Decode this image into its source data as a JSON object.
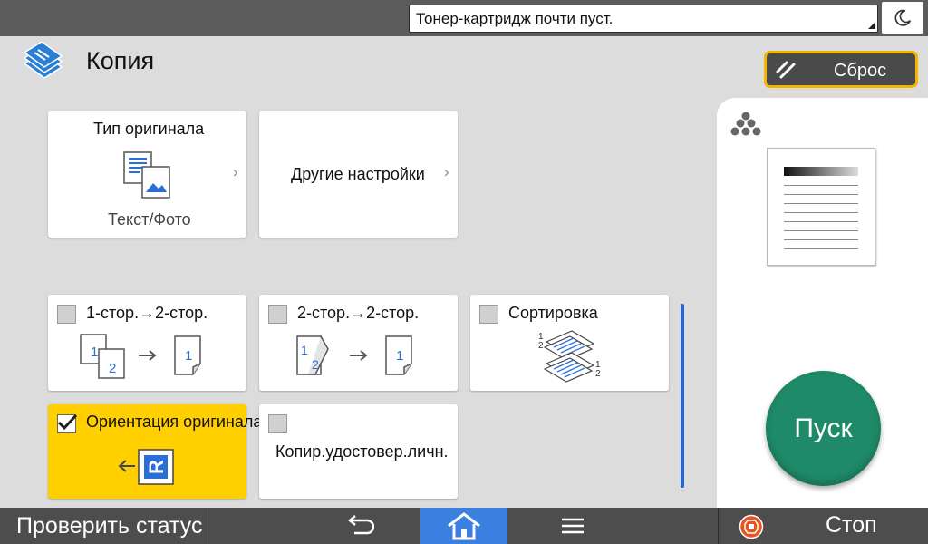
{
  "topbar": {
    "status_message": "Тонер-картридж почти пуст.",
    "night_mode_icon": "moon-icon"
  },
  "header": {
    "title": "Копия",
    "app_icon": "copy-icon",
    "reset_label": "Сброс",
    "reset_icon": "eraser-icon"
  },
  "tiles": {
    "original_type": {
      "title": "Тип оригинала",
      "value": "Текст/Фото",
      "icon": "text-photo-icon"
    },
    "other_settings": {
      "label": "Другие настройки"
    },
    "one_to_two": {
      "label": "1-стор.→2-стор.",
      "checked": false
    },
    "two_to_two": {
      "label": "2-стор.→2-стор.",
      "checked": false
    },
    "sort": {
      "label": "Сортировка",
      "checked": false
    },
    "orientation": {
      "label": "Ориентация оригинала",
      "checked": true
    },
    "id_copy": {
      "label": "Копир.удостовер.личн.",
      "checked": false
    }
  },
  "preview": {
    "color_mode_icon": "full-color-icon"
  },
  "start_label": "Пуск",
  "bottombar": {
    "status_label": "Проверить статус",
    "stop_label": "Стоп"
  },
  "colors": {
    "accent_yellow": "#ffcf00",
    "start_green": "#1e8a68",
    "home_blue": "#3b7fe0",
    "icon_blue": "#2a6fd6"
  }
}
